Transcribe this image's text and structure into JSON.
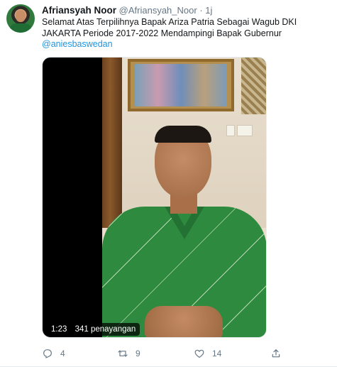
{
  "tweet": {
    "display_name": "Afriansyah Noor",
    "handle": "@Afriansyah_Noor",
    "separator": "·",
    "time": "1j",
    "text": "Selamat Atas Terpilihnya Bapak Ariza Patria Sebagai Wagub DKI JAKARTA Periode 2017-2022 Mendampingi Bapak Gubernur",
    "mention": "@aniesbaswedan"
  },
  "video": {
    "duration": "1:23",
    "views": "341 penayangan"
  },
  "actions": {
    "reply_count": "4",
    "retweet_count": "9",
    "like_count": "14",
    "reply_icon": "reply-icon",
    "retweet_icon": "retweet-icon",
    "like_icon": "heart-icon",
    "share_icon": "share-icon"
  },
  "colors": {
    "link": "#1b95e0",
    "muted": "#657786",
    "text": "#14171a"
  }
}
